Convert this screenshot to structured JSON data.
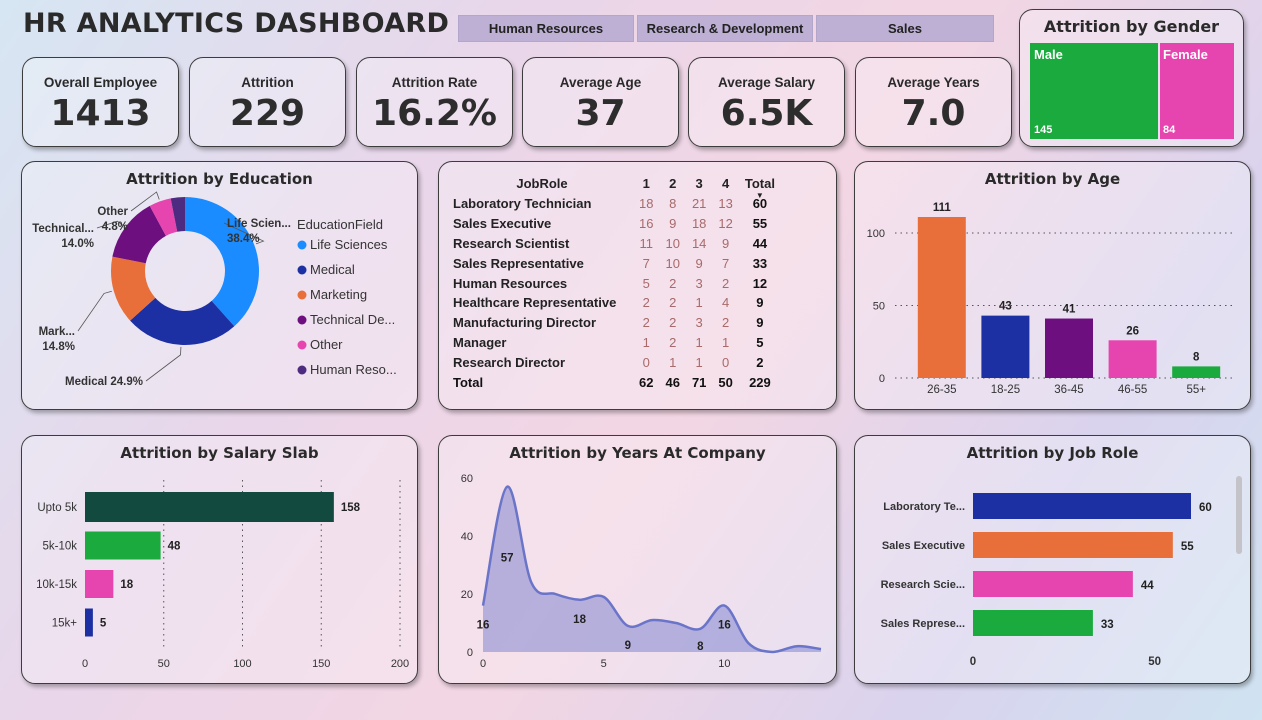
{
  "title": "HR ANALYTICS DASHBOARD",
  "slicer": [
    "Human Resources",
    "Research & Development",
    "Sales"
  ],
  "kpis": [
    {
      "label": "Overall Employee",
      "value": "1413"
    },
    {
      "label": "Attrition",
      "value": "229"
    },
    {
      "label": "Attrition Rate",
      "value": "16.2%"
    },
    {
      "label": "Average Age",
      "value": "37"
    },
    {
      "label": "Average Salary",
      "value": "6.5K"
    },
    {
      "label": "Average Years",
      "value": "7.0"
    }
  ],
  "gender": {
    "title": "Attrition by Gender",
    "items": [
      {
        "label": "Male",
        "value": "145",
        "color": "#1aaa3e"
      },
      {
        "label": "Female",
        "value": "84",
        "color": "#e645b0"
      }
    ]
  },
  "education": {
    "title": "Attrition by Education",
    "legend_title": "EducationField"
  },
  "matrix": {
    "headers": [
      "JobRole",
      "1",
      "2",
      "3",
      "4",
      "Total"
    ],
    "rows": [
      [
        "Laboratory Technician",
        "18",
        "8",
        "21",
        "13",
        "60"
      ],
      [
        "Sales Executive",
        "16",
        "9",
        "18",
        "12",
        "55"
      ],
      [
        "Research Scientist",
        "11",
        "10",
        "14",
        "9",
        "44"
      ],
      [
        "Sales Representative",
        "7",
        "10",
        "9",
        "7",
        "33"
      ],
      [
        "Human Resources",
        "5",
        "2",
        "3",
        "2",
        "12"
      ],
      [
        "Healthcare Representative",
        "2",
        "2",
        "1",
        "4",
        "9"
      ],
      [
        "Manufacturing Director",
        "2",
        "2",
        "3",
        "2",
        "9"
      ],
      [
        "Manager",
        "1",
        "2",
        "1",
        "1",
        "5"
      ],
      [
        "Research Director",
        "0",
        "1",
        "1",
        "0",
        "2"
      ]
    ],
    "total": [
      "Total",
      "62",
      "46",
      "71",
      "50",
      "229"
    ]
  },
  "age": {
    "title": "Attrition by Age"
  },
  "salary": {
    "title": "Attrition by Salary Slab"
  },
  "years": {
    "title": "Attrition by Years At Company"
  },
  "jobrole": {
    "title": "Attrition by Job Role"
  },
  "chart_data": [
    {
      "id": "education",
      "type": "pie",
      "title": "Attrition by Education",
      "legend_title": "EducationField",
      "legend_position": "right",
      "slices": [
        {
          "name": "Life Sciences",
          "value": 38.4,
          "color": "#1a8cff",
          "label": "Life Scien...\n38.4%"
        },
        {
          "name": "Medical",
          "value": 24.9,
          "color": "#1c2fa3",
          "label": "Medical 24.9%"
        },
        {
          "name": "Marketing",
          "value": 14.8,
          "color": "#e86f3a",
          "label": "Mark...\n14.8%"
        },
        {
          "name": "Technical De...",
          "value": 14.0,
          "color": "#6e0f80",
          "label": "Technical...\n14.0%"
        },
        {
          "name": "Other",
          "value": 4.8,
          "color": "#e645b0",
          "label": "Other\n4.8%"
        },
        {
          "name": "Human Reso...",
          "value": 3.1,
          "color": "#4d2b80",
          "label": ""
        }
      ]
    },
    {
      "id": "age",
      "type": "bar",
      "title": "Attrition by Age",
      "categories": [
        "26-35",
        "18-25",
        "36-45",
        "46-55",
        "55+"
      ],
      "values": [
        111,
        43,
        41,
        26,
        8
      ],
      "colors": [
        "#e86f3a",
        "#1c2fa3",
        "#6e0f80",
        "#e645b0",
        "#1aaa3e"
      ],
      "ylim": [
        0,
        111
      ],
      "yticks": [
        0,
        50,
        100
      ]
    },
    {
      "id": "salary",
      "type": "bar",
      "orientation": "horizontal",
      "title": "Attrition by Salary Slab",
      "categories": [
        "Upto 5k",
        "5k-10k",
        "10k-15k",
        "15k+"
      ],
      "values": [
        158,
        48,
        18,
        5
      ],
      "colors": [
        "#134a3f",
        "#1aaa3e",
        "#e645b0",
        "#1c2fa3"
      ],
      "xlim": [
        0,
        200
      ],
      "xticks": [
        0,
        50,
        100,
        150,
        200
      ]
    },
    {
      "id": "years",
      "type": "area",
      "title": "Attrition by Years At Company",
      "x": [
        0,
        1,
        2,
        3,
        4,
        5,
        6,
        7,
        8,
        9,
        10,
        11,
        12,
        13,
        14
      ],
      "y": [
        16,
        57,
        24,
        20,
        18,
        19,
        9,
        11,
        10,
        8,
        16,
        3,
        0,
        2,
        1
      ],
      "labels": [
        {
          "x": 0,
          "text": "16"
        },
        {
          "x": 1,
          "text": "57"
        },
        {
          "x": 4,
          "text": "18"
        },
        {
          "x": 6,
          "text": "9"
        },
        {
          "x": 9,
          "text": "8"
        },
        {
          "x": 10,
          "text": "16"
        }
      ],
      "ylim": [
        0,
        60
      ],
      "yticks": [
        0,
        20,
        40,
        60
      ],
      "xticks": [
        0,
        5,
        10
      ],
      "color": "#6a74c9"
    },
    {
      "id": "jobrole",
      "type": "bar",
      "orientation": "horizontal",
      "title": "Attrition by Job Role",
      "categories": [
        "Laboratory Te...",
        "Sales Executive",
        "Research Scie...",
        "Sales Represe..."
      ],
      "values": [
        60,
        55,
        44,
        33
      ],
      "colors": [
        "#1c2fa3",
        "#e86f3a",
        "#e645b0",
        "#1aaa3e"
      ],
      "xlim": [
        0,
        60
      ],
      "xticks": [
        0,
        50
      ]
    }
  ]
}
